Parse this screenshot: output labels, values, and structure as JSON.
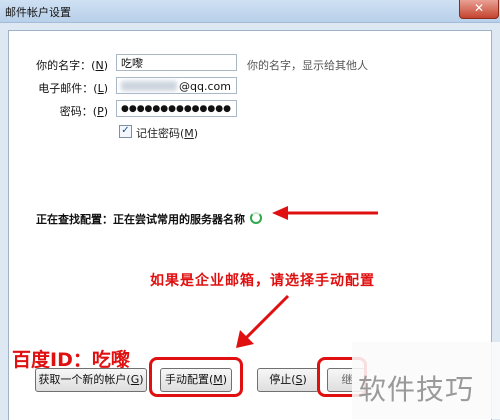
{
  "window": {
    "title": "邮件帐户设置",
    "close_glyph": "✕"
  },
  "form": {
    "name_label": "你的名字：",
    "name_key": "N",
    "name_value": "吃嚟",
    "name_hint": "你的名字，显示给其他人",
    "email_label": "电子邮件：",
    "email_key": "L",
    "email_value": "@qq.com",
    "password_label": "密码：",
    "password_key": "P",
    "password_value": "●●●●●●●●●●●●●●",
    "remember_label": "记住密码(",
    "remember_key": "M",
    "remember_checked": true
  },
  "status": {
    "text": "正在查找配置：正在尝试常用的服务器名称"
  },
  "annotations": {
    "note": "如果是企业邮箱，请选择手动配置",
    "baidu_id": "百度ID：吃嚟",
    "watermark": "软件技巧",
    "color": "#e01010"
  },
  "buttons": {
    "get_account": "获取一个新的帐户(",
    "get_account_key": "G",
    "manual": "手动配置(",
    "manual_key": "M",
    "stop": "停止(",
    "stop_key": "S",
    "continue_partial": "继"
  }
}
